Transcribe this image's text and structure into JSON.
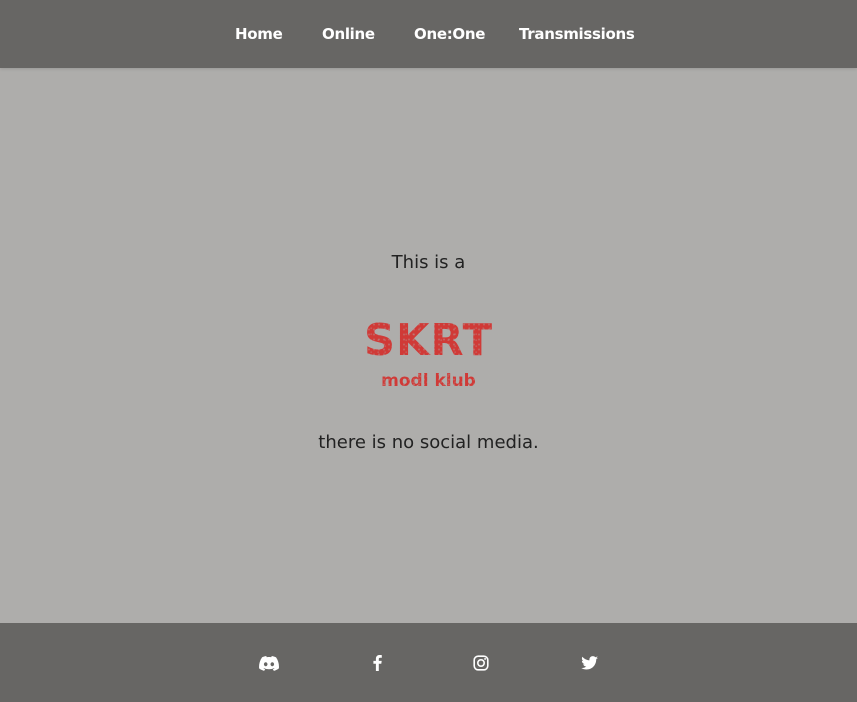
{
  "nav": {
    "items": [
      {
        "label": "Home"
      },
      {
        "label": "Online"
      },
      {
        "label": "One:One"
      },
      {
        "label": "Transmissions"
      }
    ]
  },
  "main": {
    "intro": "This is a",
    "logo": {
      "main": "SKRT",
      "sub": "modl klub"
    },
    "outro": "there is no social media."
  },
  "footer": {
    "icons": [
      "discord-icon",
      "facebook-icon",
      "instagram-icon",
      "twitter-icon"
    ]
  },
  "colors": {
    "nav_bg": "#676664",
    "page_bg": "#aeadab",
    "logo_red": "#d03a37",
    "text_dark": "#222222"
  }
}
